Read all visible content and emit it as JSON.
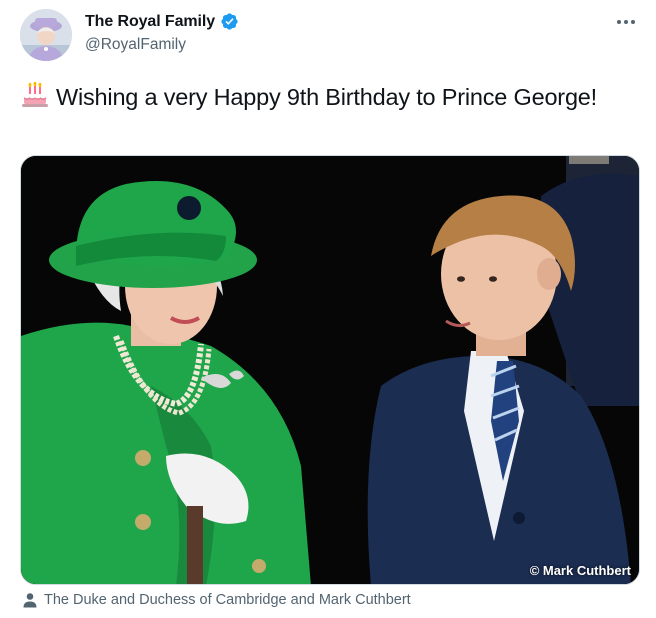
{
  "author": {
    "display_name": "The Royal Family",
    "handle": "@RoyalFamily",
    "verified": true
  },
  "tweet": {
    "emoji": "cake-icon",
    "text": "Wishing a very Happy 9th Birthday to Prince George!"
  },
  "media": {
    "credit": "© Mark Cuthbert"
  },
  "tagged": {
    "label": "The Duke and Duchess of Cambridge and Mark Cuthbert"
  },
  "colors": {
    "verified_blue": "#1d9bf0",
    "secondary_text": "#536471",
    "primary_text": "#0f1419"
  }
}
